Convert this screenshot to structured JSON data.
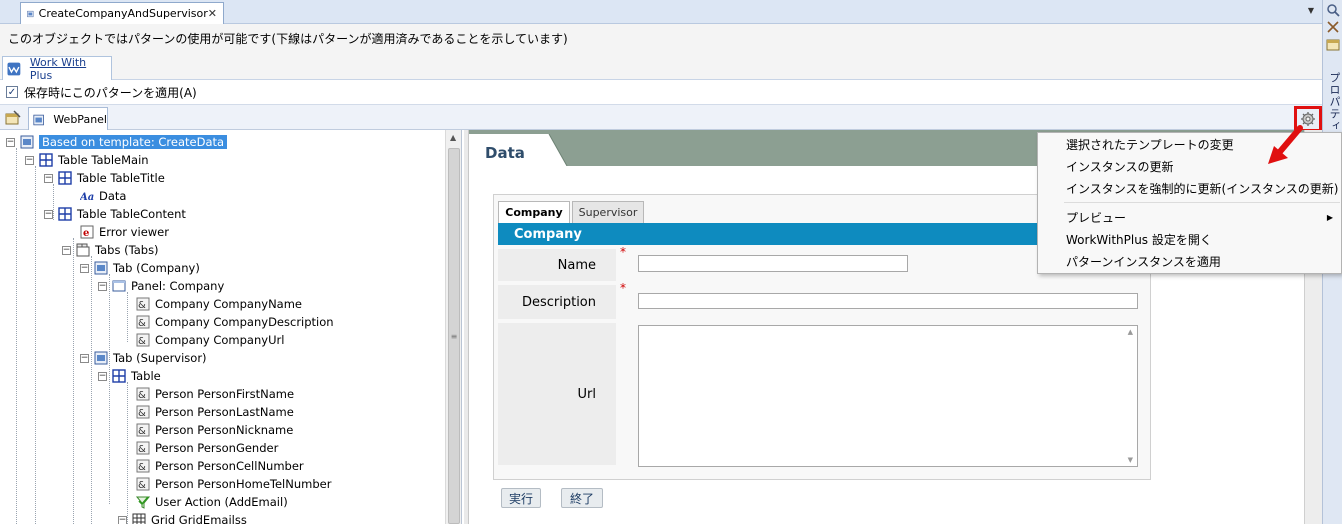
{
  "window": {
    "tab_title": "CreateCompanyAndSupervisor",
    "tab_close": "✕",
    "dropdown": "▼"
  },
  "info_bar": "このオブジェクトではパターンの使用が可能です(下線はパターンが適用済みであることを示しています)",
  "pattern_tab": "Work With Plus",
  "apply_on_save": {
    "label": "保存時にこのパターンを適用(A)",
    "checked": "✓"
  },
  "toolbar": {
    "webpanel_tab": "WebPanel"
  },
  "side_panel": {
    "label": "プロパティ"
  },
  "tree": {
    "root": "Based on template: CreateData",
    "table_main": "Table TableMain",
    "table_title": "Table TableTitle",
    "data": "Data",
    "table_content": "Table TableContent",
    "error_viewer": "Error viewer",
    "tabs": "Tabs (Tabs)",
    "tab_company": "Tab (Company)",
    "panel_company": "Panel: Company",
    "company_name": "Company CompanyName",
    "company_description": "Company CompanyDescription",
    "company_url": "Company CompanyUrl",
    "tab_supervisor": "Tab (Supervisor)",
    "table": "Table",
    "person_first": "Person PersonFirstName",
    "person_last": "Person PersonLastName",
    "person_nick": "Person PersonNickname",
    "person_gender": "Person PersonGender",
    "person_cell": "Person PersonCellNumber",
    "person_home": "Person PersonHomeTelNumber",
    "user_action": "User Action (AddEmail)",
    "grid_emails": "Grid GridEmailss"
  },
  "canvas": {
    "header_title": "Data",
    "tab_company": "Company",
    "tab_supervisor": "Supervisor",
    "band_title": "Company",
    "fields": {
      "name": "Name",
      "description": "Description",
      "url": "Url"
    },
    "required_mark": "*",
    "buttons": {
      "run": "実行",
      "close": "終了"
    }
  },
  "context_menu": {
    "change_template": "選択されたテンプレートの変更",
    "update_instance": "インスタンスの更新",
    "force_update": "インスタンスを強制的に更新(インスタンスの更新)",
    "preview": "プレビュー",
    "preview_arrow": "▶",
    "open_settings": "WorkWithPlus 設定を開く",
    "apply_instance": "パターンインスタンスを適用"
  },
  "colors": {
    "accent_band": "#0e8bbf",
    "highlight_border": "#e01010",
    "selection": "#3b8ee0"
  }
}
